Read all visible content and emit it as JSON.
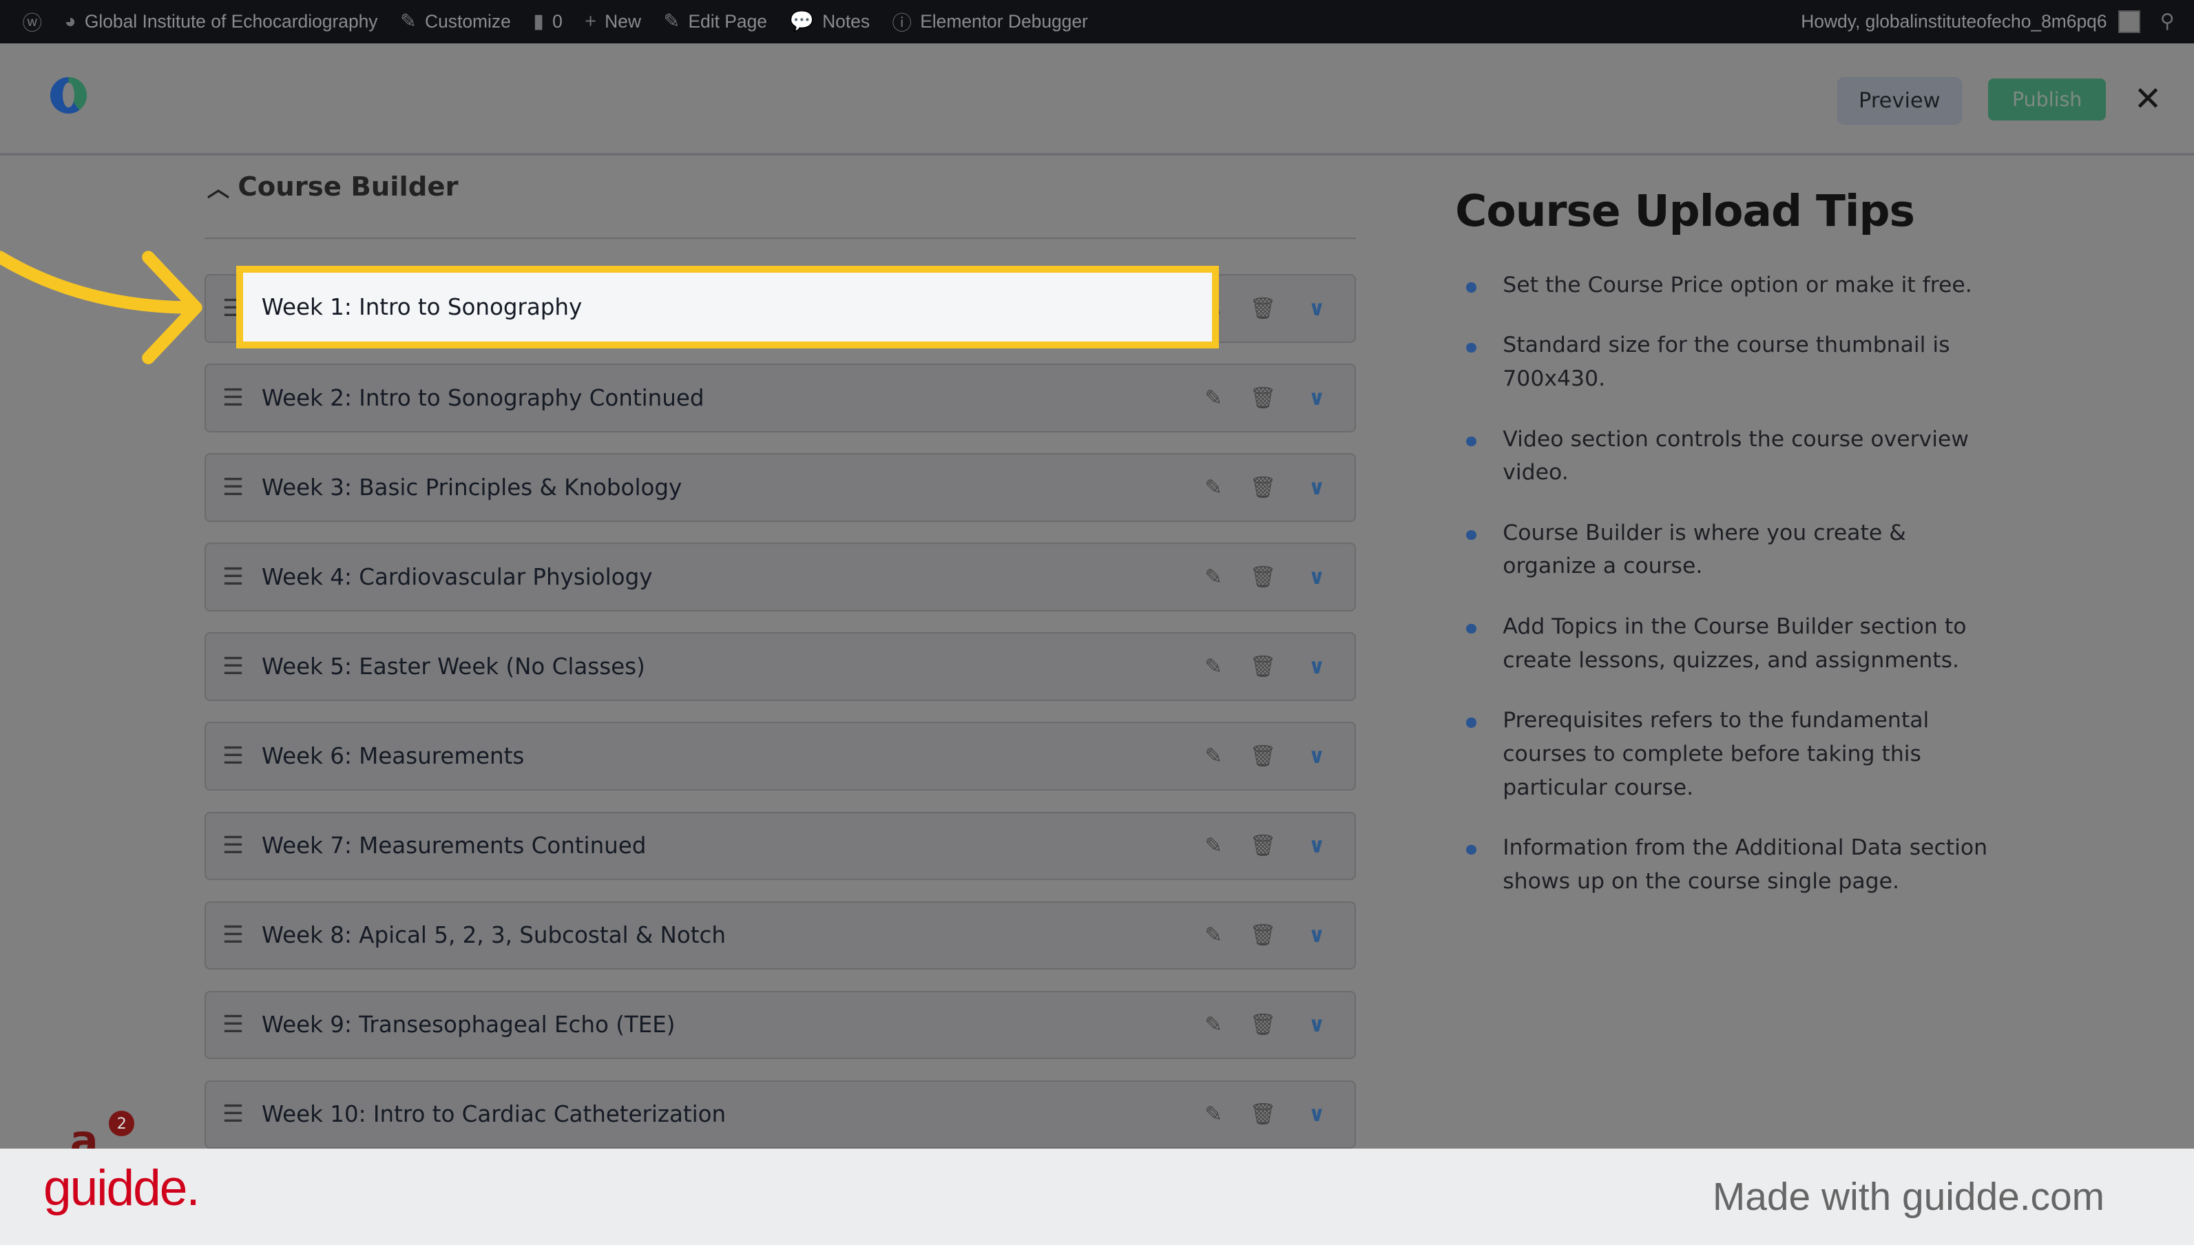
{
  "wp_bar": {
    "site_name": "Global Institute of Echocardiography",
    "customize": "Customize",
    "comments_count": "0",
    "new": "New",
    "edit_page": "Edit Page",
    "notes": "Notes",
    "debugger": "Elementor Debugger",
    "howdy": "Howdy, globalinstituteofecho_8m6pq6"
  },
  "header": {
    "preview": "Preview",
    "publish": "Publish",
    "close": "✕"
  },
  "course_builder": {
    "title": "Course Builder",
    "topics": [
      "Week 1: Intro to Sonography",
      "Week 2: Intro to Sonography Continued",
      "Week 3: Basic Principles & Knobology",
      "Week 4: Cardiovascular Physiology",
      "Week 5: Easter Week (No Classes)",
      "Week 6: Measurements",
      "Week 7: Measurements Continued",
      "Week 8: Apical 5, 2, 3, Subcostal & Notch",
      "Week 9: Transesophageal Echo (TEE)",
      "Week 10: Intro to Cardiac Catheterization"
    ]
  },
  "tips": {
    "title": "Course Upload Tips",
    "items": [
      "Set the Course Price option or make it free.",
      "Standard size for the course thumbnail is 700x430.",
      "Video section controls the course overview video.",
      "Course Builder is where you create & organize a course.",
      "Add Topics in the Course Builder section to create lessons, quizzes, and assignments.",
      "Prerequisites refers to the fundamental courses to complete before taking this particular course.",
      "Information from the Additional Data section shows up on the course single page."
    ]
  },
  "notification_badge": "2",
  "footer": {
    "logo": "guidde.",
    "made_with": "Made with guidde.com"
  },
  "colors": {
    "highlight": "#f8c623",
    "publish": "#347357",
    "accent": "#2b5590",
    "guidde_red": "#d0021b"
  }
}
